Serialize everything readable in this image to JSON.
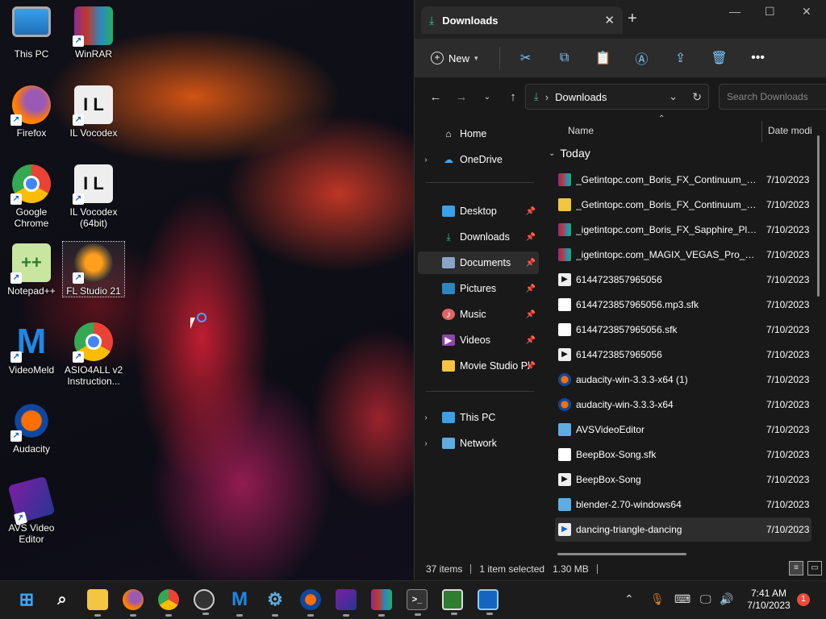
{
  "desktop": {
    "icons": [
      {
        "label": "This PC"
      },
      {
        "label": "WinRAR"
      },
      {
        "label": "Firefox"
      },
      {
        "label": "IL Vocodex"
      },
      {
        "label": "Google Chrome"
      },
      {
        "label": "IL Vocodex (64bit)"
      },
      {
        "label": "Notepad++"
      },
      {
        "label": "FL Studio 21"
      },
      {
        "label": "VideoMeld"
      },
      {
        "label": "ASIO4ALL v2 Instruction..."
      },
      {
        "label": "Audacity"
      },
      {
        "label": "AVS Video Editor"
      }
    ]
  },
  "explorer": {
    "tab_title": "Downloads",
    "new_label": "New",
    "address_path": "Downloads",
    "search_placeholder": "Search Downloads",
    "nav": {
      "home": "Home",
      "onedrive": "OneDrive",
      "desktop": "Desktop",
      "downloads": "Downloads",
      "documents": "Documents",
      "pictures": "Pictures",
      "music": "Music",
      "videos": "Videos",
      "movie_studio": "Movie Studio Pl",
      "this_pc": "This PC",
      "network": "Network"
    },
    "columns": {
      "name": "Name",
      "date": "Date modi"
    },
    "group": "Today",
    "files": [
      {
        "name": "_Getintopc.com_Boris_FX_Continuum_C...",
        "date": "7/10/2023",
        "icon": "winrar-icon"
      },
      {
        "name": "_Getintopc.com_Boris_FX_Continuum_C...",
        "date": "7/10/2023",
        "icon": "folder-icon"
      },
      {
        "name": "_igetintopc.com_Boris_FX_Sapphire_Plug...",
        "date": "7/10/2023",
        "icon": "winrar-icon"
      },
      {
        "name": "_igetintopc.com_MAGIX_VEGAS_Pro_20_...",
        "date": "7/10/2023",
        "icon": "winrar-icon"
      },
      {
        "name": "6144723857965056",
        "date": "7/10/2023",
        "icon": "audio-file-icon"
      },
      {
        "name": "6144723857965056.mp3.sfk",
        "date": "7/10/2023",
        "icon": "file-icon"
      },
      {
        "name": "6144723857965056.sfk",
        "date": "7/10/2023",
        "icon": "file-icon"
      },
      {
        "name": "6144723857965056",
        "date": "7/10/2023",
        "icon": "audio-file-icon"
      },
      {
        "name": "audacity-win-3.3.3-x64 (1)",
        "date": "7/10/2023",
        "icon": "audacity-icon"
      },
      {
        "name": "audacity-win-3.3.3-x64",
        "date": "7/10/2023",
        "icon": "audacity-icon"
      },
      {
        "name": "AVSVideoEditor",
        "date": "7/10/2023",
        "icon": "installer-icon"
      },
      {
        "name": "BeepBox-Song.sfk",
        "date": "7/10/2023",
        "icon": "file-icon"
      },
      {
        "name": "BeepBox-Song",
        "date": "7/10/2023",
        "icon": "audio-file-icon"
      },
      {
        "name": "blender-2.70-windows64",
        "date": "7/10/2023",
        "icon": "installer-icon"
      },
      {
        "name": "dancing-triangle-dancing",
        "date": "7/10/2023",
        "icon": "video-file-icon"
      }
    ],
    "status": {
      "items": "37 items",
      "selected": "1 item selected",
      "size": "1.30 MB"
    }
  },
  "taskbar": {
    "clock_time": "7:41 AM",
    "clock_date": "7/10/2023",
    "notification_count": "1"
  }
}
